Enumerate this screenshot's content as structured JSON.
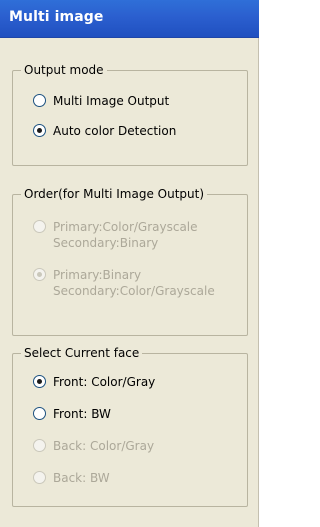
{
  "window": {
    "title": "Multi image"
  },
  "output_mode": {
    "legend": "Output mode",
    "options": [
      {
        "label": "Multi Image Output",
        "checked": false,
        "enabled": true
      },
      {
        "label": "Auto color Detection",
        "checked": true,
        "enabled": true
      }
    ]
  },
  "order": {
    "legend": "Order(for Multi Image Output)",
    "options": [
      {
        "line1": "Primary:Color/Grayscale",
        "line2": "Secondary:Binary",
        "checked": false,
        "enabled": false
      },
      {
        "line1": "Primary:Binary",
        "line2": "Secondary:Color/Grayscale",
        "checked": true,
        "enabled": false
      }
    ]
  },
  "current_face": {
    "legend": "Select Current face",
    "options": [
      {
        "label": "Front: Color/Gray",
        "checked": true,
        "enabled": true
      },
      {
        "label": "Front: BW",
        "checked": false,
        "enabled": true
      },
      {
        "label": "Back: Color/Gray",
        "checked": false,
        "enabled": false
      },
      {
        "label": "Back: BW",
        "checked": false,
        "enabled": false
      }
    ]
  },
  "colors": {
    "title_bar": "#2b5fcf",
    "panel_bg": "#ece9d8",
    "disabled_text": "#aca899"
  }
}
